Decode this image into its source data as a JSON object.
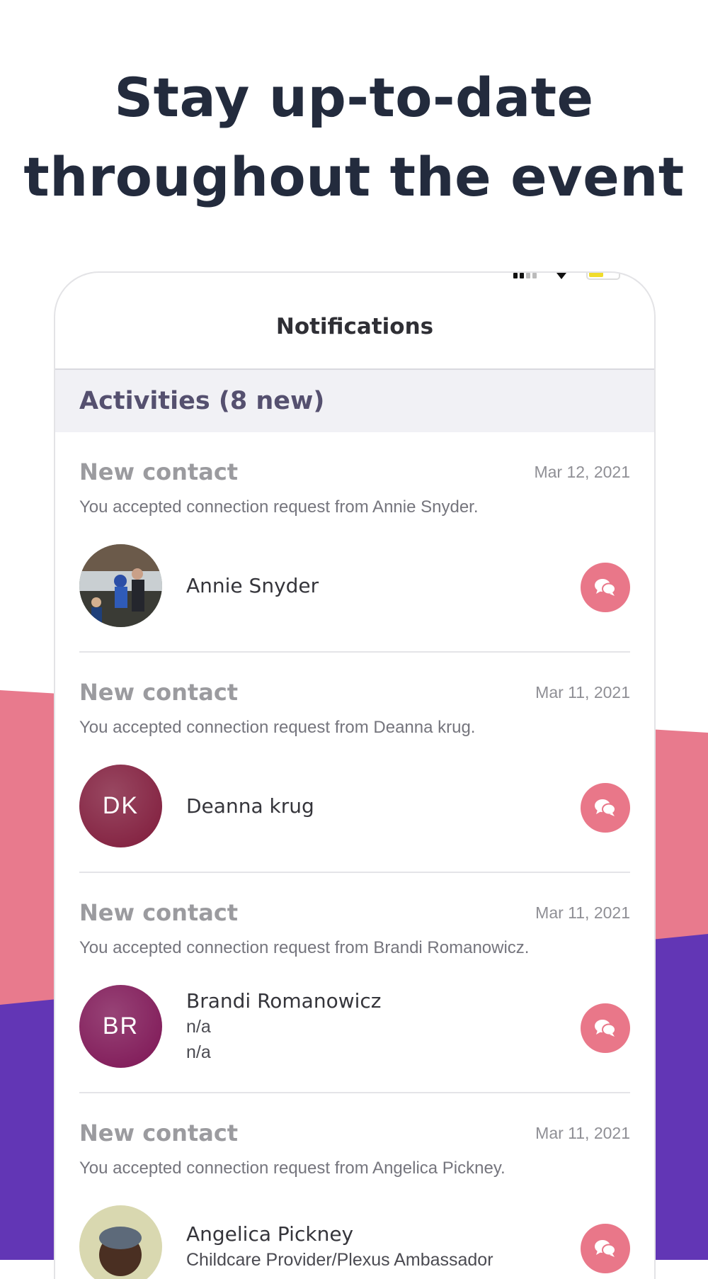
{
  "headline": {
    "line1": "Stay up-to-date",
    "line2": "throughout the event"
  },
  "colors": {
    "brand_pink": "#e97789",
    "brand_purple": "#6236b5",
    "band_pink": "#e87a8d",
    "headline": "#232b3d",
    "section_text": "#55506f"
  },
  "screen": {
    "title": "Notifications",
    "section_label": "Activities (8 new)",
    "items": [
      {
        "title": "New contact",
        "date": "Mar 12, 2021",
        "description": "You accepted connection request from Annie Snyder.",
        "name": "Annie Snyder",
        "avatar_type": "photo",
        "avatar_initials": "",
        "lines": [],
        "action_icon": "chat-bubbles-icon"
      },
      {
        "title": "New contact",
        "date": "Mar 11, 2021",
        "description": "You accepted connection request from Deanna krug.",
        "name": "Deanna krug",
        "avatar_type": "initials",
        "avatar_initials": "DK",
        "avatar_color": "#7f1a3a",
        "lines": [],
        "action_icon": "chat-bubbles-icon"
      },
      {
        "title": "New contact",
        "date": "Mar 11, 2021",
        "description": "You accepted connection request from Brandi Romanowicz.",
        "name": "Brandi Romanowicz",
        "avatar_type": "initials",
        "avatar_initials": "BR",
        "avatar_color": "#7d1454",
        "lines": [
          "n/a",
          "n/a"
        ],
        "action_icon": "chat-bubbles-icon"
      },
      {
        "title": "New contact",
        "date": "Mar 11, 2021",
        "description": "You accepted connection request from Angelica Pickney.",
        "name": "Angelica Pickney",
        "avatar_type": "photo",
        "avatar_initials": "",
        "lines": [
          "Childcare Provider/Plexus Ambassador"
        ],
        "action_icon": "chat-bubbles-icon"
      }
    ]
  }
}
